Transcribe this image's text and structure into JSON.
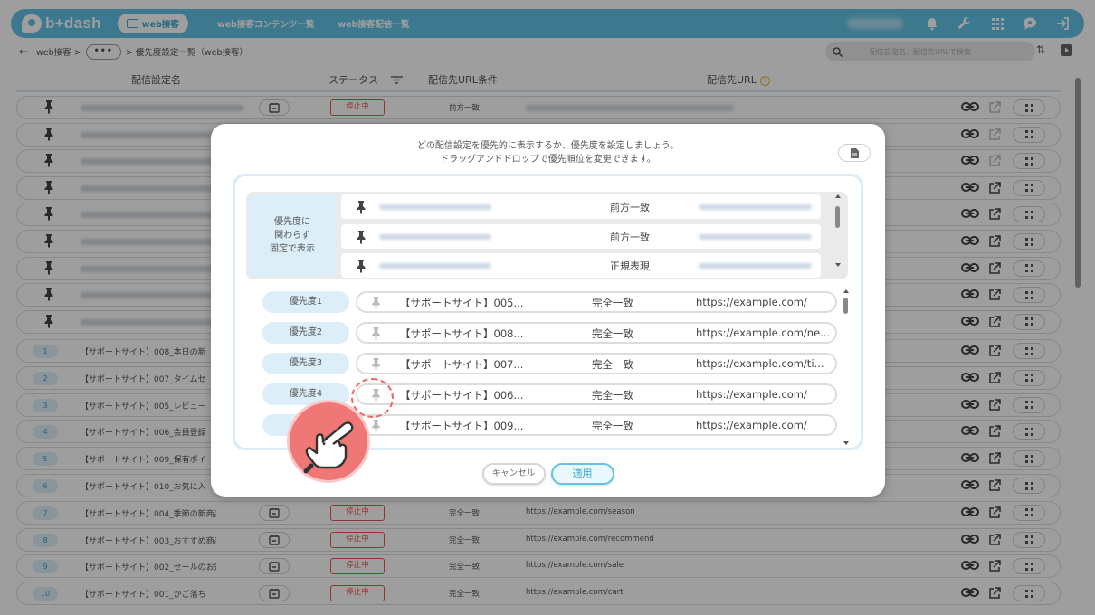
{
  "app": {
    "logo_text": "b+dash",
    "mode_pill": "web接客",
    "nav": [
      "web接客コンテンツ一覧",
      "web接客配信一覧"
    ],
    "accent_color": "#62c3e6"
  },
  "subbar": {
    "breadcrumb_root": "web接客 >",
    "breadcrumb_dots": "•••",
    "breadcrumb_current": "> 優先度設定一覧（web接客）",
    "search_placeholder": "配信設定名、配信先URLで検索"
  },
  "table": {
    "headers": {
      "name": "配信設定名",
      "status": "ステータス",
      "condition": "配信先URL条件",
      "url": "配信先URL"
    },
    "fixed_rows": [
      {
        "status": "停止中",
        "condition": "前方一致"
      }
    ],
    "rows": [
      {
        "num": "1",
        "name": "【サポートサイト】008_本日の新"
      },
      {
        "num": "2",
        "name": "【サポートサイト】007_タイムセ"
      },
      {
        "num": "3",
        "name": "【サポートサイト】005_レビュー"
      },
      {
        "num": "4",
        "name": "【サポートサイト】006_会員登録"
      },
      {
        "num": "5",
        "name": "【サポートサイト】009_保有ポイ"
      },
      {
        "num": "6",
        "name": "【サポートサイト】010_お気に入"
      },
      {
        "num": "7",
        "name": "【サポートサイト】004_季節の新商品",
        "status": "停止中",
        "condition": "完全一致",
        "url": "https://example.com/season"
      },
      {
        "num": "8",
        "name": "【サポートサイト】003_おすすめ商品",
        "status": "停止中",
        "condition": "完全一致",
        "url": "https://example.com/recommend"
      },
      {
        "num": "9",
        "name": "【サポートサイト】002_セールのお知...",
        "status": "停止中",
        "condition": "完全一致",
        "url": "https://example.com/sale"
      },
      {
        "num": "10",
        "name": "【サポートサイト】001_かご落ち",
        "status": "停止中",
        "condition": "完全一致",
        "url": "https://example.com/cart"
      }
    ]
  },
  "modal": {
    "message_line1": "どの配信設定を優先的に表示するか、優先度を設定しましょう。",
    "message_line2": "ドラッグアンドドロップで優先順位を変更できます。",
    "fixed_label": [
      "優先度に",
      "関わらず",
      "固定で表示"
    ],
    "fixed_rows": [
      {
        "condition": "前方一致"
      },
      {
        "condition": "前方一致"
      },
      {
        "condition": "正規表現"
      }
    ],
    "priority_rows": [
      {
        "label": "優先度1",
        "name": "【サポートサイト】005...",
        "condition": "完全一致",
        "url": "https://example.com/"
      },
      {
        "label": "優先度2",
        "name": "【サポートサイト】008...",
        "condition": "完全一致",
        "url": "https://example.com/ne..."
      },
      {
        "label": "優先度3",
        "name": "【サポートサイト】007...",
        "condition": "完全一致",
        "url": "https://example.com/ti..."
      },
      {
        "label": "優先度4",
        "name": "【サポートサイト】006...",
        "condition": "完全一致",
        "url": "https://example.com/"
      },
      {
        "label": "",
        "name": "【サポートサイト】009...",
        "condition": "完全一致",
        "url": "https://example.com/"
      }
    ],
    "cancel_label": "キャンセル",
    "apply_label": "適用"
  }
}
